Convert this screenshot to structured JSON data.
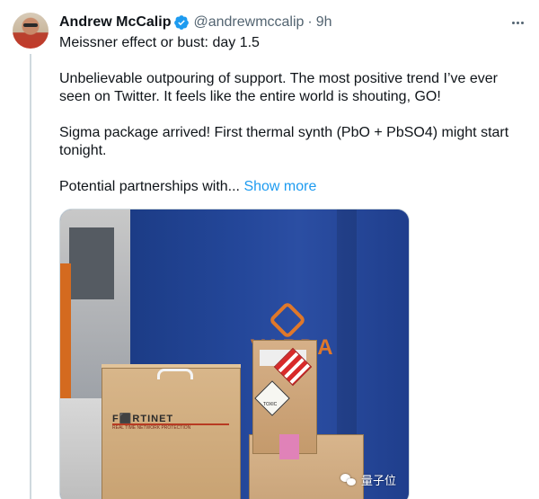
{
  "author": {
    "name": "Andrew McCalip",
    "handle": "@andrewmccalip",
    "separator": "·",
    "time": "9h",
    "verified": true,
    "avatar_icon": "user-avatar"
  },
  "tweet": {
    "line1": "Meissner effect or bust: day 1.5",
    "para2": "Unbelievable outpouring of support. The most positive trend I’ve ever seen on Twitter. It feels like the entire world is shouting, GO!",
    "para3": "Sigma package arrived! First thermal synth (PbO + PbSO4) might start tonight.",
    "para4_text": "Potential partnerships with...",
    "show_more": "Show more"
  },
  "media": {
    "banner_text": "VARDA",
    "box_brand": "F⬛RTINET",
    "box_subtext": "REAL TIME NETWORK PROTECTION",
    "hazard_label": "TOXIC"
  },
  "watermark": {
    "text": "量子位"
  },
  "colors": {
    "link": "#1d9bf0",
    "verified": "#1d9bf0",
    "muted": "#536471",
    "text": "#0f1419"
  },
  "icons": {
    "verified": "verified-badge-icon",
    "more": "more-options-icon",
    "watermark": "wechat-icon"
  }
}
